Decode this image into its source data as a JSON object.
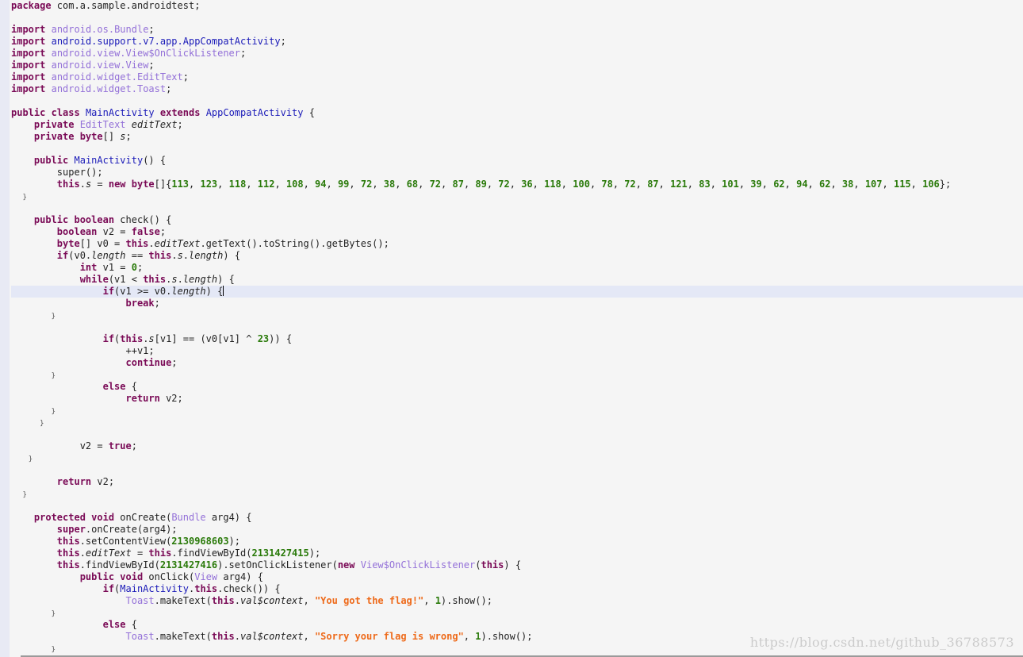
{
  "editor": {
    "watermark": "https://blog.csdn.net/github_36788573",
    "active_line": 24,
    "lines": [
      [
        [
          "k",
          "package"
        ],
        [
          "m",
          " com.a.sample.androidtest;"
        ]
      ],
      [],
      [
        [
          "k",
          "import"
        ],
        [
          "m",
          " "
        ],
        [
          "t",
          "android.os.Bundle"
        ],
        [
          "m",
          ";"
        ]
      ],
      [
        [
          "k",
          "import"
        ],
        [
          "m",
          " "
        ],
        [
          "c",
          "android.support.v7.app.AppCompatActivity"
        ],
        [
          "m",
          ";"
        ]
      ],
      [
        [
          "k",
          "import"
        ],
        [
          "m",
          " "
        ],
        [
          "t",
          "android.view.View$OnClickListener"
        ],
        [
          "m",
          ";"
        ]
      ],
      [
        [
          "k",
          "import"
        ],
        [
          "m",
          " "
        ],
        [
          "t",
          "android.view.View"
        ],
        [
          "m",
          ";"
        ]
      ],
      [
        [
          "k",
          "import"
        ],
        [
          "m",
          " "
        ],
        [
          "t",
          "android.widget.EditText"
        ],
        [
          "m",
          ";"
        ]
      ],
      [
        [
          "k",
          "import"
        ],
        [
          "m",
          " "
        ],
        [
          "t",
          "android.widget.Toast"
        ],
        [
          "m",
          ";"
        ]
      ],
      [],
      [
        [
          "k",
          "public class"
        ],
        [
          "m",
          " "
        ],
        [
          "c",
          "MainActivity"
        ],
        [
          "m",
          " "
        ],
        [
          "k",
          "extends"
        ],
        [
          "m",
          " "
        ],
        [
          "c",
          "AppCompatActivity"
        ],
        [
          "m",
          " {"
        ]
      ],
      [
        [
          "m",
          "    "
        ],
        [
          "k",
          "private"
        ],
        [
          "m",
          " "
        ],
        [
          "t",
          "EditText"
        ],
        [
          "m",
          " "
        ],
        [
          "i",
          "editText"
        ],
        [
          "m",
          ";"
        ]
      ],
      [
        [
          "m",
          "    "
        ],
        [
          "k",
          "private byte"
        ],
        [
          "m",
          "[] "
        ],
        [
          "i",
          "s"
        ],
        [
          "m",
          ";"
        ]
      ],
      [],
      [
        [
          "m",
          "    "
        ],
        [
          "k",
          "public"
        ],
        [
          "m",
          " "
        ],
        [
          "c",
          "MainActivity"
        ],
        [
          "m",
          "() {"
        ]
      ],
      [
        [
          "m",
          "        super();"
        ]
      ],
      [
        [
          "m",
          "        "
        ],
        [
          "k",
          "this"
        ],
        [
          "m",
          "."
        ],
        [
          "i",
          "s"
        ],
        [
          "m",
          " = "
        ],
        [
          "k",
          "new byte"
        ],
        [
          "m",
          "[]{"
        ],
        [
          "n",
          "113"
        ],
        [
          "m",
          ", "
        ],
        [
          "n",
          "123"
        ],
        [
          "m",
          ", "
        ],
        [
          "n",
          "118"
        ],
        [
          "m",
          ", "
        ],
        [
          "n",
          "112"
        ],
        [
          "m",
          ", "
        ],
        [
          "n",
          "108"
        ],
        [
          "m",
          ", "
        ],
        [
          "n",
          "94"
        ],
        [
          "m",
          ", "
        ],
        [
          "n",
          "99"
        ],
        [
          "m",
          ", "
        ],
        [
          "n",
          "72"
        ],
        [
          "m",
          ", "
        ],
        [
          "n",
          "38"
        ],
        [
          "m",
          ", "
        ],
        [
          "n",
          "68"
        ],
        [
          "m",
          ", "
        ],
        [
          "n",
          "72"
        ],
        [
          "m",
          ", "
        ],
        [
          "n",
          "87"
        ],
        [
          "m",
          ", "
        ],
        [
          "n",
          "89"
        ],
        [
          "m",
          ", "
        ],
        [
          "n",
          "72"
        ],
        [
          "m",
          ", "
        ],
        [
          "n",
          "36"
        ],
        [
          "m",
          ", "
        ],
        [
          "n",
          "118"
        ],
        [
          "m",
          ", "
        ],
        [
          "n",
          "100"
        ],
        [
          "m",
          ", "
        ],
        [
          "n",
          "78"
        ],
        [
          "m",
          ", "
        ],
        [
          "n",
          "72"
        ],
        [
          "m",
          ", "
        ],
        [
          "n",
          "87"
        ],
        [
          "m",
          ", "
        ],
        [
          "n",
          "121"
        ],
        [
          "m",
          ", "
        ],
        [
          "n",
          "83"
        ],
        [
          "m",
          ", "
        ],
        [
          "n",
          "101"
        ],
        [
          "m",
          ", "
        ],
        [
          "n",
          "39"
        ],
        [
          "m",
          ", "
        ],
        [
          "n",
          "62"
        ],
        [
          "m",
          ", "
        ],
        [
          "n",
          "94"
        ],
        [
          "m",
          ", "
        ],
        [
          "n",
          "62"
        ],
        [
          "m",
          ", "
        ],
        [
          "n",
          "38"
        ],
        [
          "m",
          ", "
        ],
        [
          "n",
          "107"
        ],
        [
          "m",
          ", "
        ],
        [
          "n",
          "115"
        ],
        [
          "m",
          ", "
        ],
        [
          "n",
          "106"
        ],
        [
          "m",
          "};"
        ]
      ],
      [
        [
          "m",
          "  "
        ],
        [
          "b",
          "}"
        ]
      ],
      [],
      [
        [
          "m",
          "    "
        ],
        [
          "k",
          "public boolean"
        ],
        [
          "m",
          " check() {"
        ]
      ],
      [
        [
          "m",
          "        "
        ],
        [
          "k",
          "boolean"
        ],
        [
          "m",
          " v2 = "
        ],
        [
          "k",
          "false"
        ],
        [
          "m",
          ";"
        ]
      ],
      [
        [
          "m",
          "        "
        ],
        [
          "k",
          "byte"
        ],
        [
          "m",
          "[] v0 = "
        ],
        [
          "k",
          "this"
        ],
        [
          "m",
          "."
        ],
        [
          "i",
          "editText"
        ],
        [
          "m",
          ".getText().toString().getBytes();"
        ]
      ],
      [
        [
          "m",
          "        "
        ],
        [
          "k",
          "if"
        ],
        [
          "m",
          "(v0."
        ],
        [
          "i",
          "length"
        ],
        [
          "m",
          " == "
        ],
        [
          "k",
          "this"
        ],
        [
          "m",
          "."
        ],
        [
          "i",
          "s"
        ],
        [
          "m",
          "."
        ],
        [
          "i",
          "length"
        ],
        [
          "m",
          ") {"
        ]
      ],
      [
        [
          "m",
          "            "
        ],
        [
          "k",
          "int"
        ],
        [
          "m",
          " v1 = "
        ],
        [
          "n",
          "0"
        ],
        [
          "m",
          ";"
        ]
      ],
      [
        [
          "m",
          "            "
        ],
        [
          "k",
          "while"
        ],
        [
          "m",
          "(v1 < "
        ],
        [
          "k",
          "this"
        ],
        [
          "m",
          "."
        ],
        [
          "i",
          "s"
        ],
        [
          "m",
          "."
        ],
        [
          "i",
          "length"
        ],
        [
          "m",
          ") {"
        ]
      ],
      [
        [
          "m",
          "                "
        ],
        [
          "k",
          "if"
        ],
        [
          "m",
          "(v1 >= v0."
        ],
        [
          "i",
          "length"
        ],
        [
          "m",
          ") {"
        ],
        [
          "caret",
          ""
        ]
      ],
      [
        [
          "m",
          "                    "
        ],
        [
          "k",
          "break"
        ],
        [
          "m",
          ";"
        ]
      ],
      [
        [
          "m",
          "       "
        ],
        [
          "b",
          "}"
        ]
      ],
      [],
      [
        [
          "m",
          "                "
        ],
        [
          "k",
          "if"
        ],
        [
          "m",
          "("
        ],
        [
          "k",
          "this"
        ],
        [
          "m",
          "."
        ],
        [
          "i",
          "s"
        ],
        [
          "m",
          "[v1] == (v0[v1] ^ "
        ],
        [
          "n",
          "23"
        ],
        [
          "m",
          ")) {"
        ]
      ],
      [
        [
          "m",
          "                    ++v1;"
        ]
      ],
      [
        [
          "m",
          "                    "
        ],
        [
          "k",
          "continue"
        ],
        [
          "m",
          ";"
        ]
      ],
      [
        [
          "m",
          "       "
        ],
        [
          "b",
          "}"
        ]
      ],
      [
        [
          "m",
          "                "
        ],
        [
          "k",
          "else"
        ],
        [
          "m",
          " {"
        ]
      ],
      [
        [
          "m",
          "                    "
        ],
        [
          "k",
          "return"
        ],
        [
          "m",
          " v2;"
        ]
      ],
      [
        [
          "m",
          "       "
        ],
        [
          "b",
          "}"
        ]
      ],
      [
        [
          "m",
          "     "
        ],
        [
          "b",
          "}"
        ]
      ],
      [],
      [
        [
          "m",
          "            v2 = "
        ],
        [
          "k",
          "true"
        ],
        [
          "m",
          ";"
        ]
      ],
      [
        [
          "m",
          "   "
        ],
        [
          "b",
          "}"
        ]
      ],
      [],
      [
        [
          "m",
          "        "
        ],
        [
          "k",
          "return"
        ],
        [
          "m",
          " v2;"
        ]
      ],
      [
        [
          "m",
          "  "
        ],
        [
          "b",
          "}"
        ]
      ],
      [],
      [
        [
          "m",
          "    "
        ],
        [
          "k",
          "protected void"
        ],
        [
          "m",
          " onCreate("
        ],
        [
          "t",
          "Bundle"
        ],
        [
          "m",
          " arg4) {"
        ]
      ],
      [
        [
          "m",
          "        "
        ],
        [
          "k",
          "super"
        ],
        [
          "m",
          ".onCreate(arg4);"
        ]
      ],
      [
        [
          "m",
          "        "
        ],
        [
          "k",
          "this"
        ],
        [
          "m",
          ".setContentView("
        ],
        [
          "n",
          "2130968603"
        ],
        [
          "m",
          ");"
        ]
      ],
      [
        [
          "m",
          "        "
        ],
        [
          "k",
          "this"
        ],
        [
          "m",
          "."
        ],
        [
          "i",
          "editText"
        ],
        [
          "m",
          " = "
        ],
        [
          "k",
          "this"
        ],
        [
          "m",
          ".findViewById("
        ],
        [
          "n",
          "2131427415"
        ],
        [
          "m",
          ");"
        ]
      ],
      [
        [
          "m",
          "        "
        ],
        [
          "k",
          "this"
        ],
        [
          "m",
          ".findViewById("
        ],
        [
          "n",
          "2131427416"
        ],
        [
          "m",
          ").setOnClickListener("
        ],
        [
          "k",
          "new"
        ],
        [
          "m",
          " "
        ],
        [
          "t",
          "View$OnClickListener"
        ],
        [
          "m",
          "("
        ],
        [
          "k",
          "this"
        ],
        [
          "m",
          ") {"
        ]
      ],
      [
        [
          "m",
          "            "
        ],
        [
          "k",
          "public void"
        ],
        [
          "m",
          " onClick("
        ],
        [
          "t",
          "View"
        ],
        [
          "m",
          " arg4) {"
        ]
      ],
      [
        [
          "m",
          "                "
        ],
        [
          "k",
          "if"
        ],
        [
          "m",
          "("
        ],
        [
          "c",
          "MainActivity"
        ],
        [
          "m",
          "."
        ],
        [
          "k",
          "this"
        ],
        [
          "m",
          ".check()) {"
        ]
      ],
      [
        [
          "m",
          "                    "
        ],
        [
          "t",
          "Toast"
        ],
        [
          "m",
          ".makeText("
        ],
        [
          "k",
          "this"
        ],
        [
          "m",
          "."
        ],
        [
          "i",
          "val$context"
        ],
        [
          "m",
          ", "
        ],
        [
          "s",
          "\"You got the flag!\""
        ],
        [
          "m",
          ", "
        ],
        [
          "n",
          "1"
        ],
        [
          "m",
          ").show();"
        ]
      ],
      [
        [
          "m",
          "       "
        ],
        [
          "b",
          "}"
        ]
      ],
      [
        [
          "m",
          "                "
        ],
        [
          "k",
          "else"
        ],
        [
          "m",
          " {"
        ]
      ],
      [
        [
          "m",
          "                    "
        ],
        [
          "t",
          "Toast"
        ],
        [
          "m",
          ".makeText("
        ],
        [
          "k",
          "this"
        ],
        [
          "m",
          "."
        ],
        [
          "i",
          "val$context"
        ],
        [
          "m",
          ", "
        ],
        [
          "s",
          "\"Sorry your flag is wrong\""
        ],
        [
          "m",
          ", "
        ],
        [
          "n",
          "1"
        ],
        [
          "m",
          ").show();"
        ]
      ],
      [
        [
          "m",
          "       "
        ],
        [
          "b",
          "}"
        ]
      ]
    ]
  }
}
